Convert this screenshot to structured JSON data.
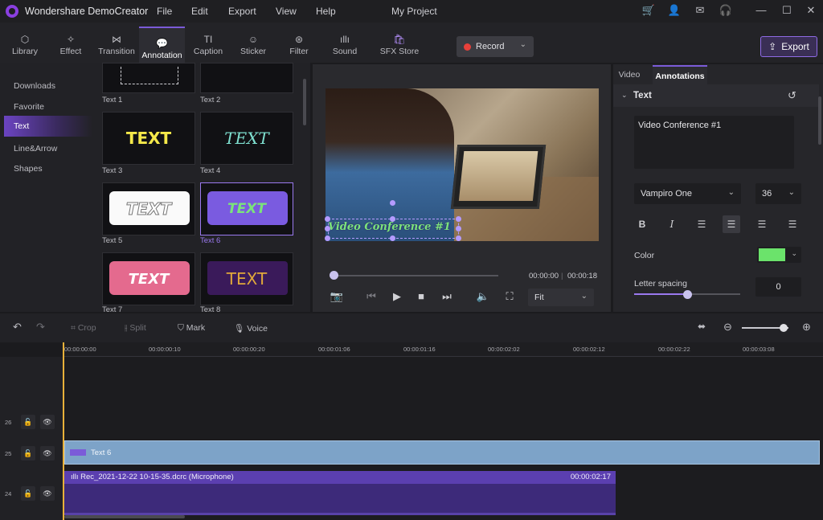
{
  "app": {
    "name": "Wondershare DemoCreator",
    "project": "My Project"
  },
  "menu": [
    "File",
    "Edit",
    "Export",
    "View",
    "Help"
  ],
  "window_controls": {
    "cart": "cart-icon",
    "user": "user-icon",
    "mail": "mail-icon",
    "headset": "headset-icon"
  },
  "toolbar": {
    "tabs": [
      "Library",
      "Effect",
      "Transition",
      "Annotation",
      "Caption",
      "Sticker",
      "Filter",
      "Sound",
      "SFX Store"
    ],
    "active_tab": "Annotation",
    "record_label": "Record",
    "export_label": "Export"
  },
  "categories": [
    "Downloads",
    "Favorite",
    "Text",
    "Line&Arrow",
    "Shapes"
  ],
  "active_category": "Text",
  "thumbnails": [
    {
      "caption": "Text 1",
      "text": ""
    },
    {
      "caption": "Text 2",
      "text": ""
    },
    {
      "caption": "Text 3",
      "text": "TEXT"
    },
    {
      "caption": "Text 4",
      "text": "TEXT"
    },
    {
      "caption": "Text 5",
      "text": "TEXT"
    },
    {
      "caption": "Text 6",
      "text": "TEXT"
    },
    {
      "caption": "Text 7",
      "text": "TEXT"
    },
    {
      "caption": "Text 8",
      "text": "TEXT"
    }
  ],
  "selected_thumbnail": "Text 6",
  "preview": {
    "overlay_text": "Video Conference #1",
    "current_time": "00:00:00",
    "total_time": "00:00:18",
    "progress": 0,
    "fit_label": "Fit"
  },
  "properties": {
    "tabs": [
      "Video",
      "Annotations"
    ],
    "active_tab": "Annotations",
    "section": "Text",
    "text_value": "Video Conference #1",
    "font": "Vampiro One",
    "size": "36",
    "format_buttons": [
      "B",
      "I"
    ],
    "color_label": "Color",
    "color_value": "#6be36b",
    "letter_spacing_label": "Letter spacing",
    "letter_spacing_value": "0",
    "letter_spacing_fraction": 0.5
  },
  "timeline": {
    "tools": {
      "crop": "Crop",
      "split": "Split",
      "mark": "Mark",
      "voice": "Voice"
    },
    "ruler": [
      "00:00:00:00",
      "00:00:00:10",
      "00:00:00:20",
      "00:00:01:06",
      "00:00:01:16",
      "00:00:02:02",
      "00:00:02:12",
      "00:00:02:22",
      "00:00:03:08"
    ],
    "tracks": [
      "26",
      "25",
      "24"
    ],
    "text_clip_label": "Text 6",
    "audio_clip_label": "Rec_2021-12-22 10-15-35.dcrc (Microphone)",
    "audio_clip_duration": "00:00:02:17"
  }
}
